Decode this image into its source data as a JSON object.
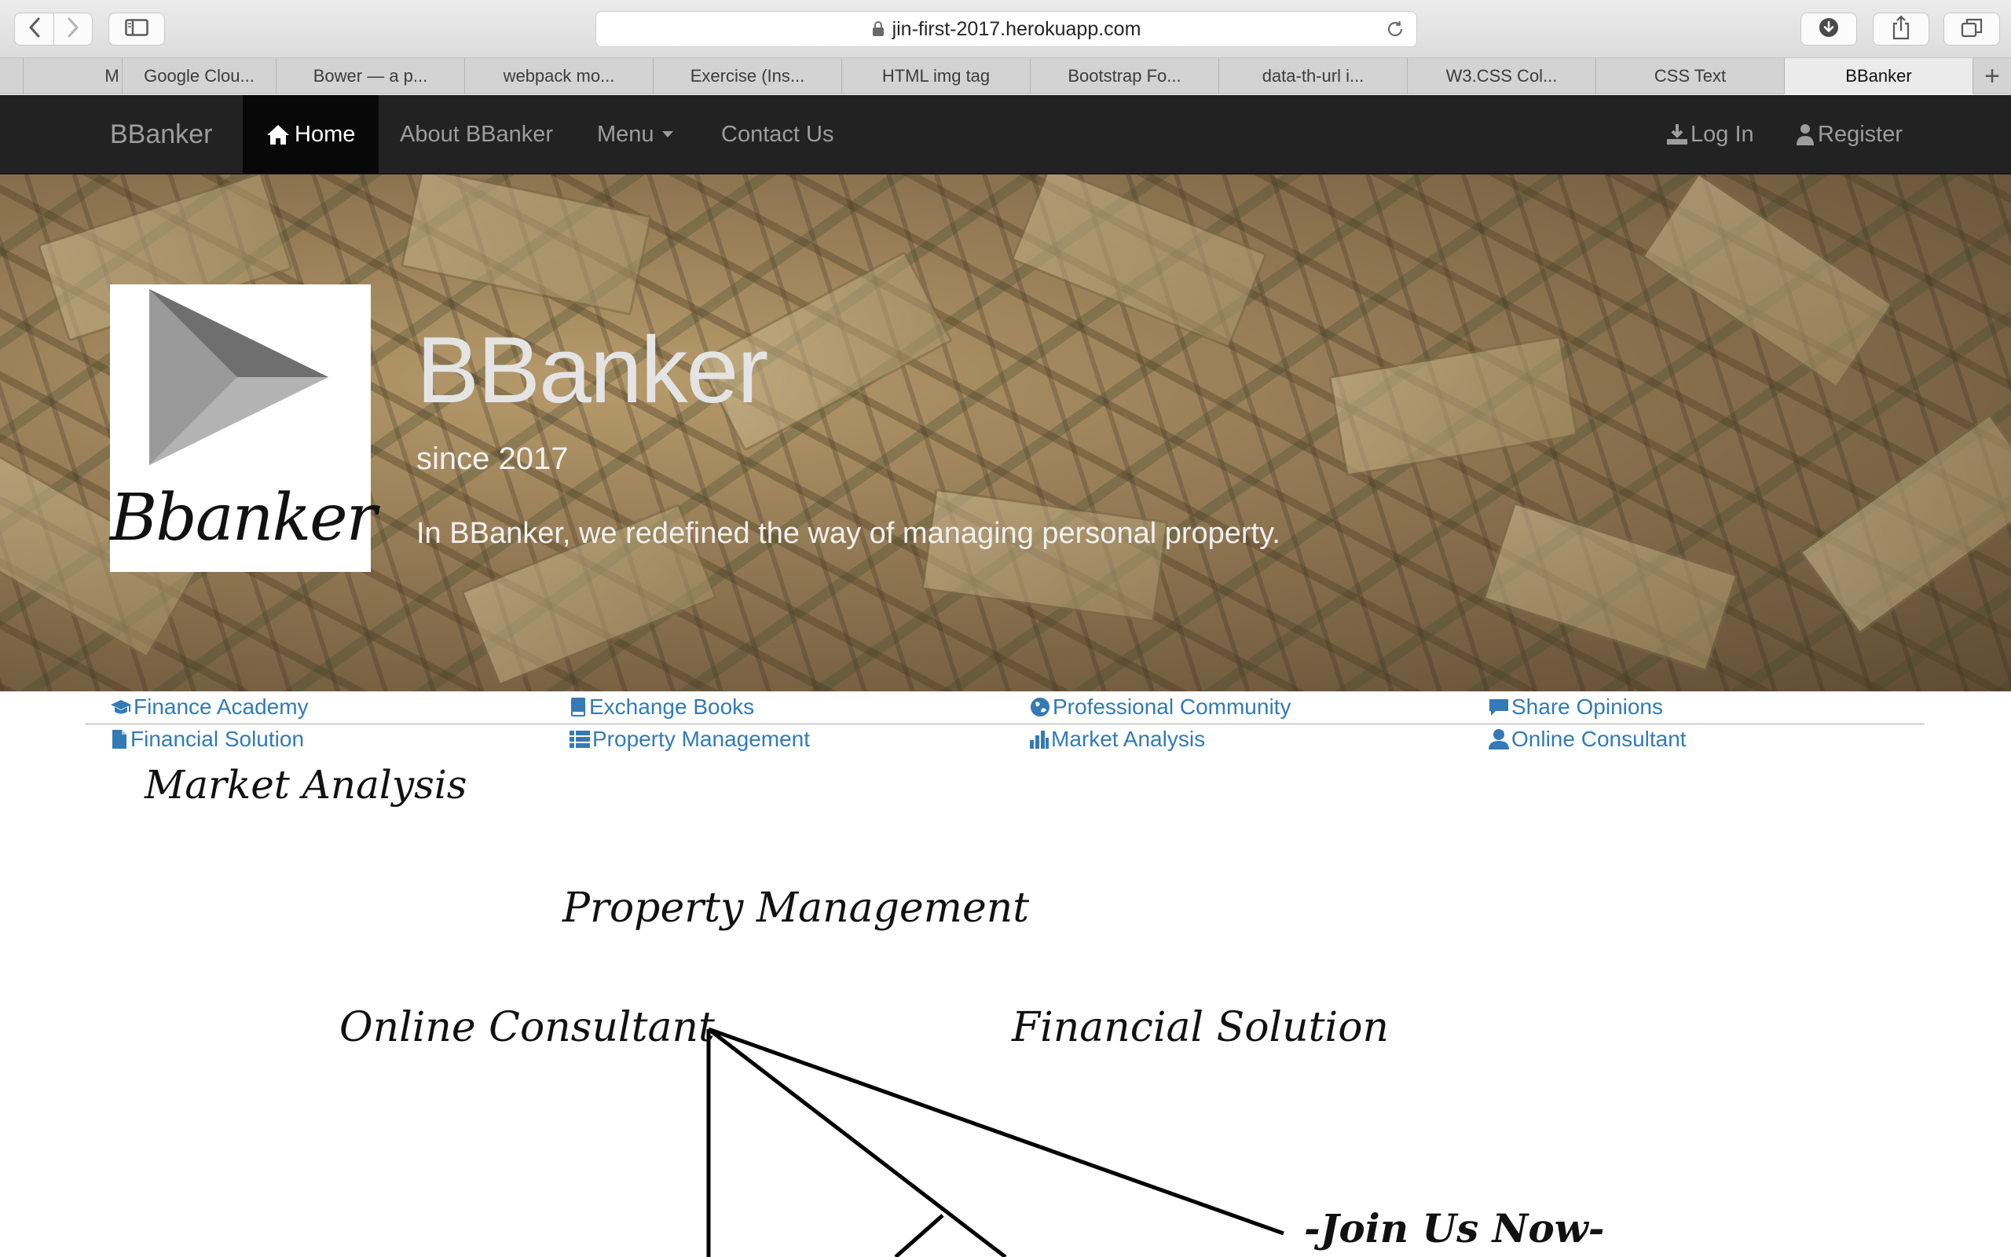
{
  "browser": {
    "url": "jin-first-2017.herokuapp.com",
    "tabs": [
      "M",
      "Google Clou...",
      "Bower — a p...",
      "webpack mo...",
      "Exercise (Ins...",
      "HTML img tag",
      "Bootstrap Fo...",
      "data-th-url i...",
      "W3.CSS Col...",
      "CSS Text",
      "BBanker"
    ],
    "active_tab_index": 10
  },
  "navbar": {
    "brand": "BBanker",
    "home": "Home",
    "about": "About BBanker",
    "menu": "Menu",
    "contact": "Contact Us",
    "login": "Log In",
    "register": "Register"
  },
  "hero": {
    "logo_text": "Bbanker",
    "title": "BBanker",
    "since": "since 2017",
    "description": "In BBanker, we redefined the way of managing personal property."
  },
  "links": {
    "row1": [
      {
        "label": "Finance Academy",
        "icon": "graduation-cap-icon"
      },
      {
        "label": "Exchange Books",
        "icon": "book-icon"
      },
      {
        "label": "Professional Community",
        "icon": "globe-icon"
      },
      {
        "label": "Share Opinions",
        "icon": "comment-icon"
      }
    ],
    "row2": [
      {
        "label": "Financial Solution",
        "icon": "file-icon"
      },
      {
        "label": "Property Management",
        "icon": "list-icon"
      },
      {
        "label": "Market Analysis",
        "icon": "bar-chart-icon"
      },
      {
        "label": "Online Consultant",
        "icon": "user-icon"
      }
    ]
  },
  "diagram": {
    "market_analysis": "Market Analysis",
    "property_management": "Property Management",
    "online_consultant": "Online Consultant",
    "financial_solution": "Financial Solution",
    "join_us": "-Join Us Now-"
  },
  "colors": {
    "link": "#337ab7",
    "navbar_bg": "#222222",
    "navbar_active_bg": "#080808",
    "navbar_text": "#9d9d9d"
  }
}
